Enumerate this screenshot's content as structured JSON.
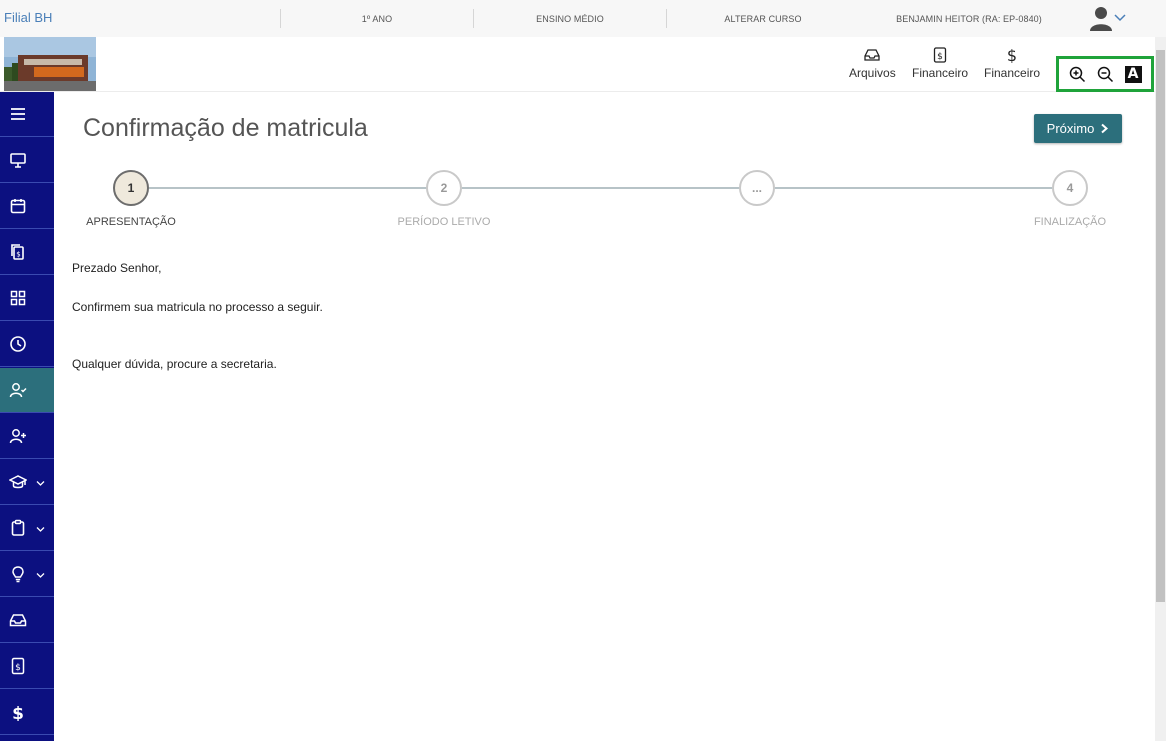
{
  "topbar": {
    "branch": "Filial BH",
    "year": "1º ANO",
    "level": "ENSINO MÉDIO",
    "change_course": "ALTERAR CURSO",
    "student": "BENJAMIN HEITOR (RA: EP-0840)"
  },
  "header": {
    "links": [
      {
        "label": "Arquivos",
        "icon": "inbox-icon"
      },
      {
        "label": "Financeiro",
        "icon": "dollar-document-icon"
      },
      {
        "label": "Financeiro",
        "icon": "dollar-icon"
      }
    ],
    "zoom_tools": [
      "zoom-in-icon",
      "zoom-out-icon",
      "font-contrast-icon"
    ],
    "font_button_glyph": "A"
  },
  "sidebar": {
    "items": [
      {
        "icon": "menu-icon"
      },
      {
        "icon": "monitor-icon"
      },
      {
        "icon": "calendar-icon"
      },
      {
        "icon": "documents-icon"
      },
      {
        "icon": "grid-icon"
      },
      {
        "icon": "clock-icon"
      },
      {
        "icon": "user-check-icon",
        "active": true
      },
      {
        "icon": "user-plus-icon"
      },
      {
        "icon": "graduation-cap-icon",
        "expandable": true
      },
      {
        "icon": "clipboard-icon",
        "expandable": true
      },
      {
        "icon": "lightbulb-icon",
        "expandable": true
      },
      {
        "icon": "inbox-icon"
      },
      {
        "icon": "dollar-document-icon"
      },
      {
        "icon": "dollar-icon"
      }
    ]
  },
  "main": {
    "title": "Confirmação de matricula",
    "next_button": "Próximo",
    "steps": [
      {
        "number": "1",
        "label": "APRESENTAÇÃO",
        "current": true
      },
      {
        "number": "2",
        "label": "PERÍODO LETIVO"
      },
      {
        "number": "...",
        "label": ""
      },
      {
        "number": "4",
        "label": "FINALIZAÇÃO"
      }
    ],
    "paragraphs": [
      "Prezado Senhor,",
      "Confirmem sua matricula no processo a seguir.",
      "Qualquer dúvida, procure a secretaria."
    ]
  },
  "colors": {
    "sidebar_bg": "#0c1080",
    "accent": "#2c6f7c",
    "highlight_border": "#1fa33a",
    "branch_text": "#4a7fb8"
  }
}
